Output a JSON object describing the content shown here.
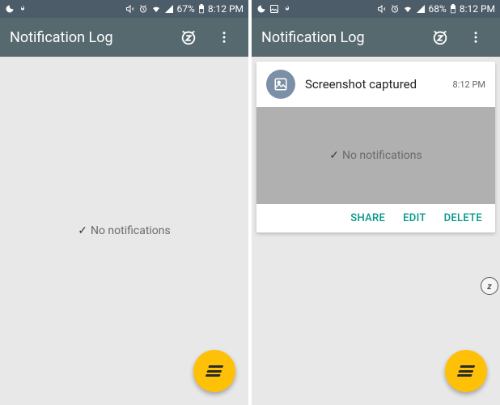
{
  "left": {
    "status": {
      "battery_pct": "67%",
      "time": "8:12 PM"
    },
    "app_title": "Notification Log",
    "empty_text": "No notifications"
  },
  "right": {
    "status": {
      "battery_pct": "68%",
      "time": "8:12 PM"
    },
    "app_title": "Notification Log",
    "card": {
      "title": "Screenshot captured",
      "time": "8:12 PM",
      "inner_empty_text": "No notifications",
      "actions": {
        "share": "SHARE",
        "edit": "EDIT",
        "delete": "DELETE"
      }
    },
    "badge": "z"
  }
}
